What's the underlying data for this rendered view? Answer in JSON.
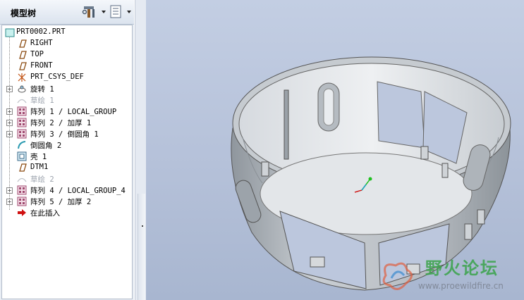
{
  "panel": {
    "title": "模型树",
    "tools_icon": "tools-icon",
    "display_icon": "tree-display-icon"
  },
  "tree": {
    "items": [
      {
        "label": "PRT0002.PRT",
        "icon": "part-icon",
        "expandable": false,
        "disabled": false
      },
      {
        "label": "RIGHT",
        "icon": "datum-plane-icon",
        "expandable": false,
        "disabled": false
      },
      {
        "label": "TOP",
        "icon": "datum-plane-icon",
        "expandable": false,
        "disabled": false
      },
      {
        "label": "FRONT",
        "icon": "datum-plane-icon",
        "expandable": false,
        "disabled": false
      },
      {
        "label": "PRT_CSYS_DEF",
        "icon": "csys-icon",
        "expandable": false,
        "disabled": false
      },
      {
        "label": "旋转 1",
        "icon": "revolve-icon",
        "expandable": true,
        "disabled": false
      },
      {
        "label": "草绘 1",
        "icon": "sketch-icon",
        "expandable": false,
        "disabled": true
      },
      {
        "label": "阵列 1 / LOCAL_GROUP",
        "icon": "pattern-icon",
        "expandable": true,
        "disabled": false
      },
      {
        "label": "阵列 2 / 加厚 1",
        "icon": "pattern-icon",
        "expandable": true,
        "disabled": false
      },
      {
        "label": "阵列 3 / 倒圆角 1",
        "icon": "pattern-icon",
        "expandable": true,
        "disabled": false
      },
      {
        "label": "倒圆角 2",
        "icon": "round-icon",
        "expandable": false,
        "disabled": false
      },
      {
        "label": "壳 1",
        "icon": "shell-icon",
        "expandable": false,
        "disabled": false
      },
      {
        "label": "DTM1",
        "icon": "datum-plane-icon",
        "expandable": false,
        "disabled": false
      },
      {
        "label": "草绘 2",
        "icon": "sketch-icon",
        "expandable": false,
        "disabled": true
      },
      {
        "label": "阵列 4 / LOCAL_GROUP_4",
        "icon": "pattern-icon",
        "expandable": true,
        "disabled": false
      },
      {
        "label": "阵列 5 / 加厚 2",
        "icon": "pattern-icon",
        "expandable": true,
        "disabled": false
      },
      {
        "label": "在此插入",
        "icon": "insert-here-arrow-icon",
        "expandable": false,
        "disabled": false
      }
    ]
  },
  "viewport": {
    "model": "revolved-ring-part"
  },
  "watermark": {
    "site_name": "野火论坛",
    "url": "www.proewildfire.cn"
  },
  "colors": {
    "viewport_bg": "#b8c4dc",
    "model_gray": "#c4c9ce",
    "pattern_icon": "#c06a8a",
    "insert_arrow": "#d01010",
    "watermark_green": "#3aa34a"
  }
}
